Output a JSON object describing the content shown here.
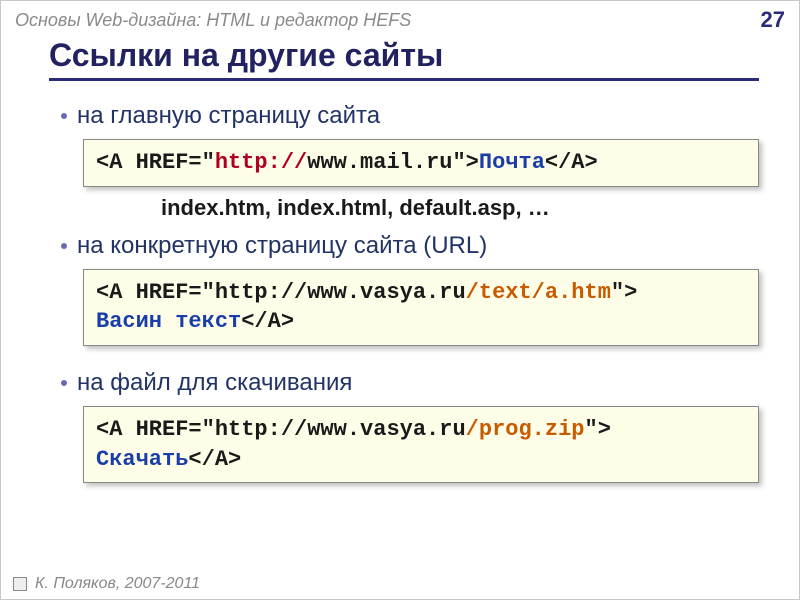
{
  "topbar": {
    "title": "Основы Web-дизайна: HTML и редактор HEFS",
    "page": "27"
  },
  "heading": "Ссылки на другие сайты",
  "section1": {
    "bullet": "на главную страницу сайта",
    "code": {
      "p1": "<A HREF=\"",
      "p2": "http://",
      "p3": "www.mail.ru\">",
      "p4": "Почта",
      "p5": "</A>"
    },
    "note": "index.htm, index.html, default.asp, …"
  },
  "section2": {
    "bullet": "на конкретную страницу сайта (URL)",
    "code": {
      "p1": "<A HREF=\"http://www.vasya.ru",
      "p2": "/text/a.htm",
      "p3": "\">",
      "p4": "\n",
      "p5": "Васин текст",
      "p6": "</A>"
    }
  },
  "section3": {
    "bullet": "на файл для скачивания",
    "code": {
      "p1": "<A HREF=\"http://www.vasya.ru",
      "p2": "/prog.zip",
      "p3": "\">",
      "p4": "\n",
      "p5": "Скачать",
      "p6": "</A>"
    }
  },
  "footer": {
    "copyright": "К. Поляков, 2007-2011"
  }
}
